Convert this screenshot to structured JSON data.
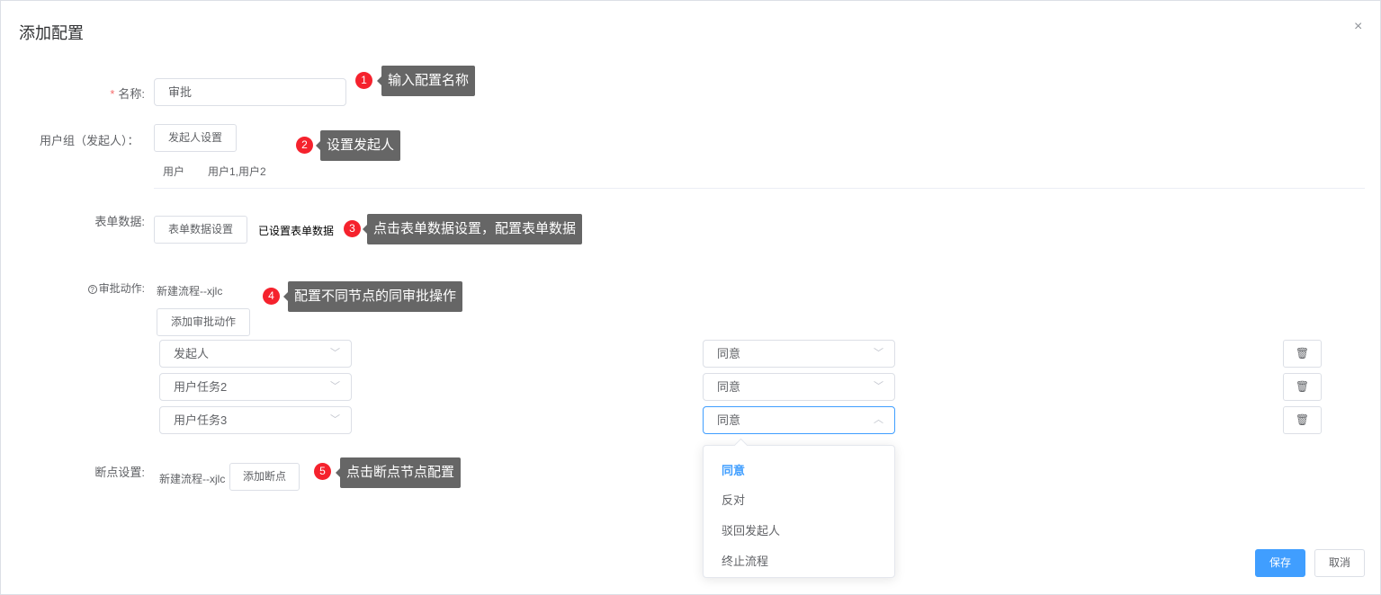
{
  "dialog": {
    "title": "添加配置",
    "close": "×"
  },
  "name": {
    "required": "*",
    "label": "名称:",
    "value": "审批"
  },
  "user_group": {
    "label": "用户组（发起人）：",
    "button": "发起人设置",
    "col1": "用户",
    "col2": "用户1,用户2"
  },
  "form_data": {
    "label": "表单数据:",
    "button": "表单数据设置",
    "status": "已设置表单数据"
  },
  "approval": {
    "help_icon": "?",
    "label": "审批动作:",
    "flow": "新建流程--xjlc",
    "add_button": "添加审批动作",
    "rows": [
      {
        "node": "发起人",
        "action": "同意"
      },
      {
        "node": "用户任务2",
        "action": "同意"
      },
      {
        "node": "用户任务3",
        "action": "同意"
      }
    ]
  },
  "dropdown": {
    "options": [
      "同意",
      "反对",
      "驳回发起人",
      "终止流程"
    ],
    "selected": "同意"
  },
  "breakpoint": {
    "label": "断点设置:",
    "flow": "新建流程--xjlc",
    "add_button": "添加断点"
  },
  "footer": {
    "save": "保存",
    "cancel": "取消"
  },
  "callouts": [
    {
      "n": "1",
      "text": "输入配置名称"
    },
    {
      "n": "2",
      "text": "设置发起人"
    },
    {
      "n": "3",
      "text": "点击表单数据设置，配置表单数据"
    },
    {
      "n": "4",
      "text": "配置不同节点的同审批操作"
    },
    {
      "n": "5",
      "text": "点击断点节点配置"
    }
  ]
}
